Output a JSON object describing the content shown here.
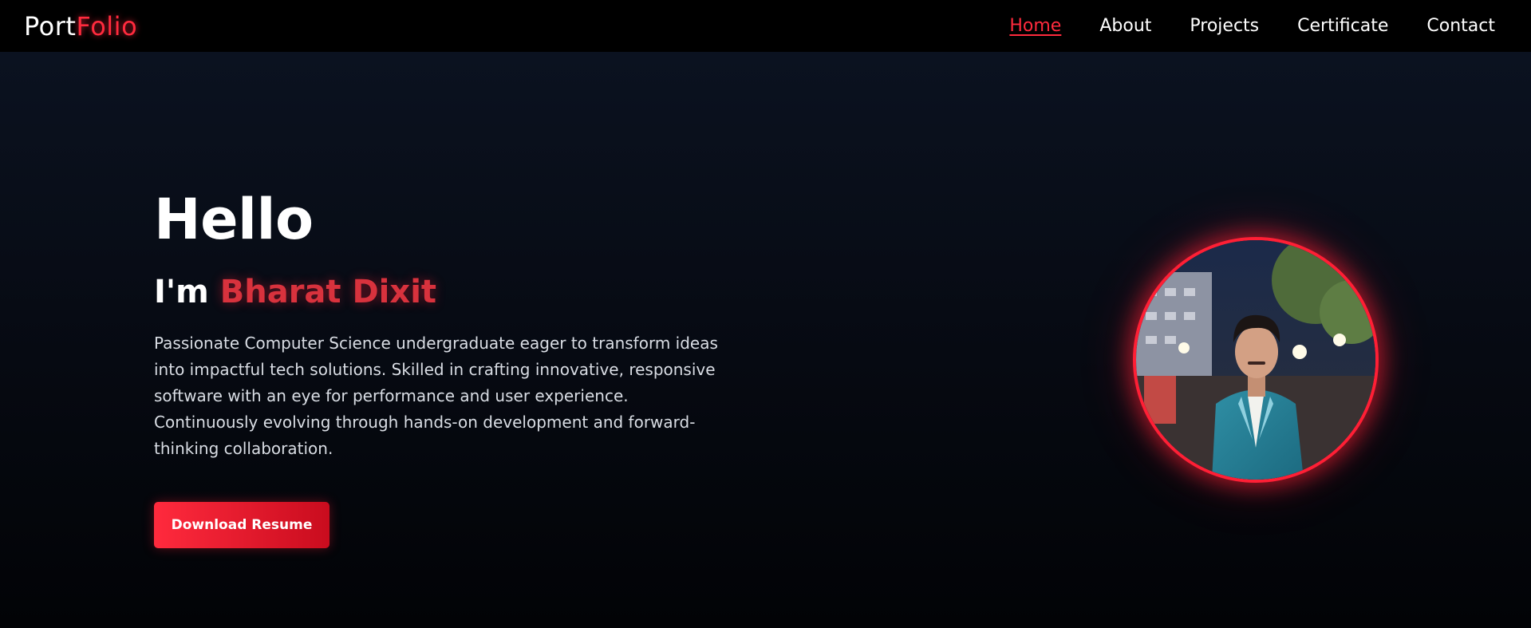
{
  "navbar": {
    "brand_part1": "Port",
    "brand_part2": "Folio",
    "links": [
      {
        "label": "Home",
        "active": true
      },
      {
        "label": "About",
        "active": false
      },
      {
        "label": "Projects",
        "active": false
      },
      {
        "label": "Certificate",
        "active": false
      },
      {
        "label": "Contact",
        "active": false
      }
    ]
  },
  "hero": {
    "greeting": "Hello",
    "intro_prefix": "I'm",
    "name": "Bharat Dixit",
    "description": "Passionate Computer Science undergraduate eager to transform ideas into impactful tech solutions. Skilled in crafting innovative, responsive software with an eye for performance and user experience. Continuously evolving through hands-on development and forward-thinking collaboration.",
    "button_label": "Download Resume"
  },
  "colors": {
    "accent": "#ff2a3d",
    "background_top": "#0b1220",
    "background_bottom": "#020306"
  }
}
